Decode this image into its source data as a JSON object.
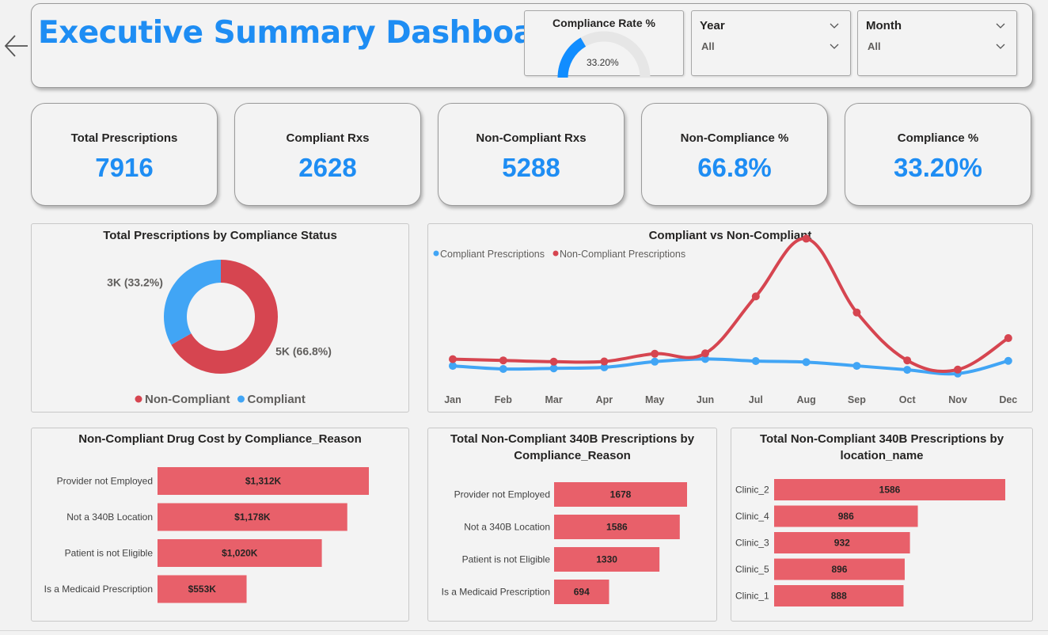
{
  "header": {
    "title": "Executive Summary Dashboard"
  },
  "gauge": {
    "title": "Compliance Rate %",
    "value_label": "33.20%",
    "value_fraction": 0.332,
    "color": "#118dff"
  },
  "slicers": [
    {
      "label": "Year",
      "value": "All"
    },
    {
      "label": "Month",
      "value": "All"
    }
  ],
  "kpis": [
    {
      "label": "Total Prescriptions",
      "value": "7916"
    },
    {
      "label": "Compliant Rxs",
      "value": "2628"
    },
    {
      "label": "Non-Compliant Rxs",
      "value": "5288"
    },
    {
      "label": "Non-Compliance %",
      "value": "66.8%"
    },
    {
      "label": "Compliance %",
      "value": "33.20%"
    }
  ],
  "colors": {
    "accent": "#1e8df3",
    "non_compliant": "#d64550",
    "compliant": "#41a5f5",
    "bar": "#e8606a"
  },
  "chart_data": [
    {
      "type": "pie",
      "title": "Total Prescriptions by Compliance Status",
      "legend_position": "bottom",
      "slices": [
        {
          "name": "Non-Compliant",
          "value": 5288,
          "label": "5K (66.8%)",
          "color": "#d64550"
        },
        {
          "name": "Compliant",
          "value": 2628,
          "label": "3K (33.2%)",
          "color": "#41a5f5"
        }
      ]
    },
    {
      "type": "line",
      "title": "Compliant vs Non-Compliant",
      "legend_position": "top-left",
      "categories": [
        "Jan",
        "Feb",
        "Mar",
        "Apr",
        "May",
        "Jun",
        "Jul",
        "Aug",
        "Sep",
        "Oct",
        "Nov",
        "Dec"
      ],
      "ylim": [
        0,
        900
      ],
      "series": [
        {
          "name": "Compliant Prescriptions",
          "color": "#41a5f5",
          "values": [
            220,
            205,
            208,
            213,
            240,
            253,
            243,
            238,
            220,
            201,
            183,
            244
          ]
        },
        {
          "name": "Non-Compliant Prescriptions",
          "color": "#d64550",
          "values": [
            252,
            246,
            240,
            241,
            278,
            280,
            553,
            830,
            476,
            246,
            202,
            353
          ]
        }
      ]
    },
    {
      "type": "bar",
      "orientation": "horizontal",
      "title": "Non-Compliant Drug Cost by Compliance_Reason",
      "categories": [
        "Provider not Employed",
        "Not a 340B Location",
        "Patient is not Eligible",
        "Is a Medicaid Prescription"
      ],
      "values": [
        1312,
        1178,
        1020,
        553
      ],
      "data_labels": [
        "$1,312K",
        "$1,178K",
        "$1,020K",
        "$553K"
      ]
    },
    {
      "type": "bar",
      "orientation": "horizontal",
      "title": "Total Non-Compliant 340B Prescriptions by Compliance_Reason",
      "categories": [
        "Provider not Employed",
        "Not a 340B Location",
        "Patient is not Eligible",
        "Is a Medicaid Prescription"
      ],
      "values": [
        1678,
        1586,
        1330,
        694
      ],
      "data_labels": [
        "1678",
        "1586",
        "1330",
        "694"
      ]
    },
    {
      "type": "bar",
      "orientation": "horizontal",
      "title": "Total Non-Compliant 340B Prescriptions by location_name",
      "categories": [
        "Clinic_2",
        "Clinic_4",
        "Clinic_3",
        "Clinic_5",
        "Clinic_1"
      ],
      "values": [
        1586,
        986,
        932,
        896,
        888
      ],
      "data_labels": [
        "1586",
        "986",
        "932",
        "896",
        "888"
      ]
    }
  ]
}
